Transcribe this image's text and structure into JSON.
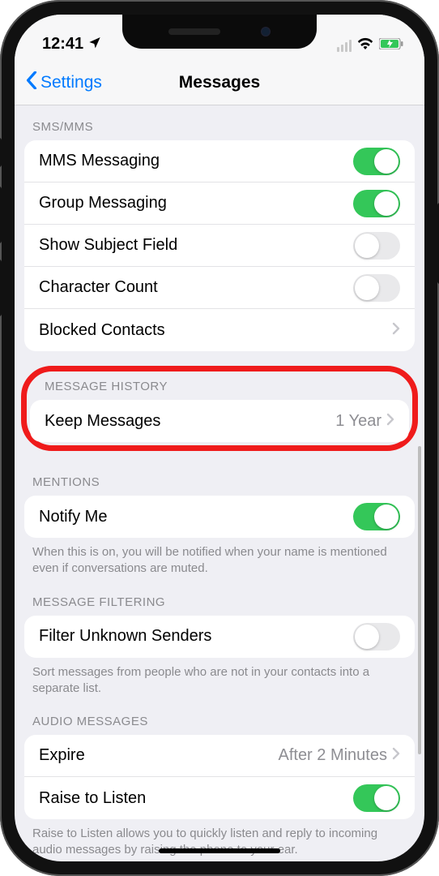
{
  "status": {
    "time": "12:41"
  },
  "nav": {
    "back": "Settings",
    "title": "Messages"
  },
  "sections": {
    "sms": {
      "header": "SMS/MMS",
      "rows": {
        "mms": {
          "label": "MMS Messaging",
          "on": true
        },
        "group": {
          "label": "Group Messaging",
          "on": true
        },
        "subject": {
          "label": "Show Subject Field",
          "on": false
        },
        "char": {
          "label": "Character Count",
          "on": false
        },
        "blocked": {
          "label": "Blocked Contacts"
        }
      }
    },
    "history": {
      "header": "MESSAGE HISTORY",
      "keep": {
        "label": "Keep Messages",
        "value": "1 Year"
      }
    },
    "mentions": {
      "header": "MENTIONS",
      "notify": {
        "label": "Notify Me",
        "on": true
      },
      "footer": "When this is on, you will be notified when your name is mentioned even if conversations are muted."
    },
    "filter": {
      "header": "MESSAGE FILTERING",
      "row": {
        "label": "Filter Unknown Senders",
        "on": false
      },
      "footer": "Sort messages from people who are not in your contacts into a separate list."
    },
    "audio": {
      "header": "AUDIO MESSAGES",
      "expire": {
        "label": "Expire",
        "value": "After 2 Minutes"
      },
      "raise": {
        "label": "Raise to Listen",
        "on": true
      },
      "footer": "Raise to Listen allows you to quickly listen and reply to incoming audio messages by raising the phone to your ear."
    }
  }
}
